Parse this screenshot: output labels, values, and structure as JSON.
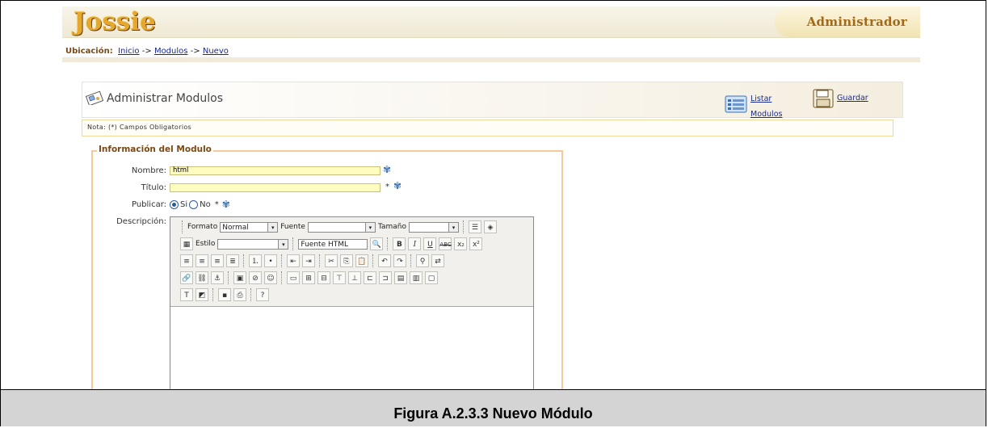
{
  "header": {
    "logo_text": "Jossie",
    "admin_title": "Administrador"
  },
  "breadcrumb": {
    "label": "Ubicación:",
    "items": [
      "Inicio",
      "Modulos",
      "Nuevo"
    ],
    "separator": "->"
  },
  "panel": {
    "title": "Administrar Modulos",
    "actions": [
      {
        "label_line1": "Listar",
        "label_line2": "Modulos"
      },
      {
        "label": "Guardar"
      }
    ]
  },
  "note": "Nota: (*) Campos Obligatorios",
  "form": {
    "legend": "Información del Modulo",
    "nombre": {
      "label": "Nombre:",
      "value": "html"
    },
    "titulo": {
      "label": "Título:",
      "value": "",
      "required": "*"
    },
    "publicar": {
      "label": "Publicar:",
      "options": [
        "Si",
        "No"
      ],
      "selected": "Si",
      "required": "*"
    },
    "descripcion": {
      "label": "Descripción:"
    }
  },
  "editor": {
    "formato_label": "Formato",
    "formato_value": "Normal",
    "fuente_label": "Fuente",
    "fuente_value": "",
    "tamano_label": "Tamaño",
    "tamano_value": "",
    "estilo_label": "Estilo",
    "estilo_value": "",
    "fuente_html_label": "Fuente HTML"
  },
  "caption": "Figura A.2.3.3 Nuevo Módulo"
}
